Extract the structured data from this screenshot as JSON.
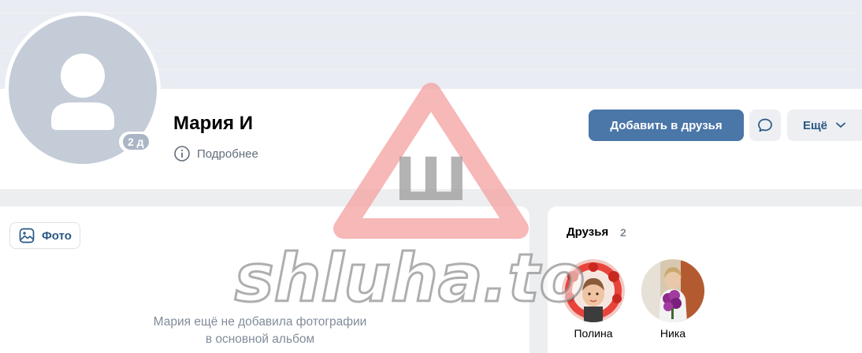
{
  "profile": {
    "name": "Мария И",
    "online_badge": "2 д",
    "details_label": "Подробнее"
  },
  "actions": {
    "add_friend_label": "Добавить в друзья",
    "more_label": "Ещё",
    "message_icon": "message-icon"
  },
  "photos": {
    "chip_label": "Фото",
    "empty_line1": "Мария ещё не добавила фотографии",
    "empty_line2": "в основной альбом"
  },
  "friends": {
    "title": "Друзья",
    "count": "2",
    "items": [
      {
        "name": "Полина"
      },
      {
        "name": "Ника"
      }
    ]
  },
  "watermark": {
    "letter": "Ш",
    "text": "shluha.to"
  },
  "colors": {
    "accent": "#4a76a8",
    "link": "#2a5885",
    "muted": "#818c99",
    "page_bg": "#edeef0"
  }
}
